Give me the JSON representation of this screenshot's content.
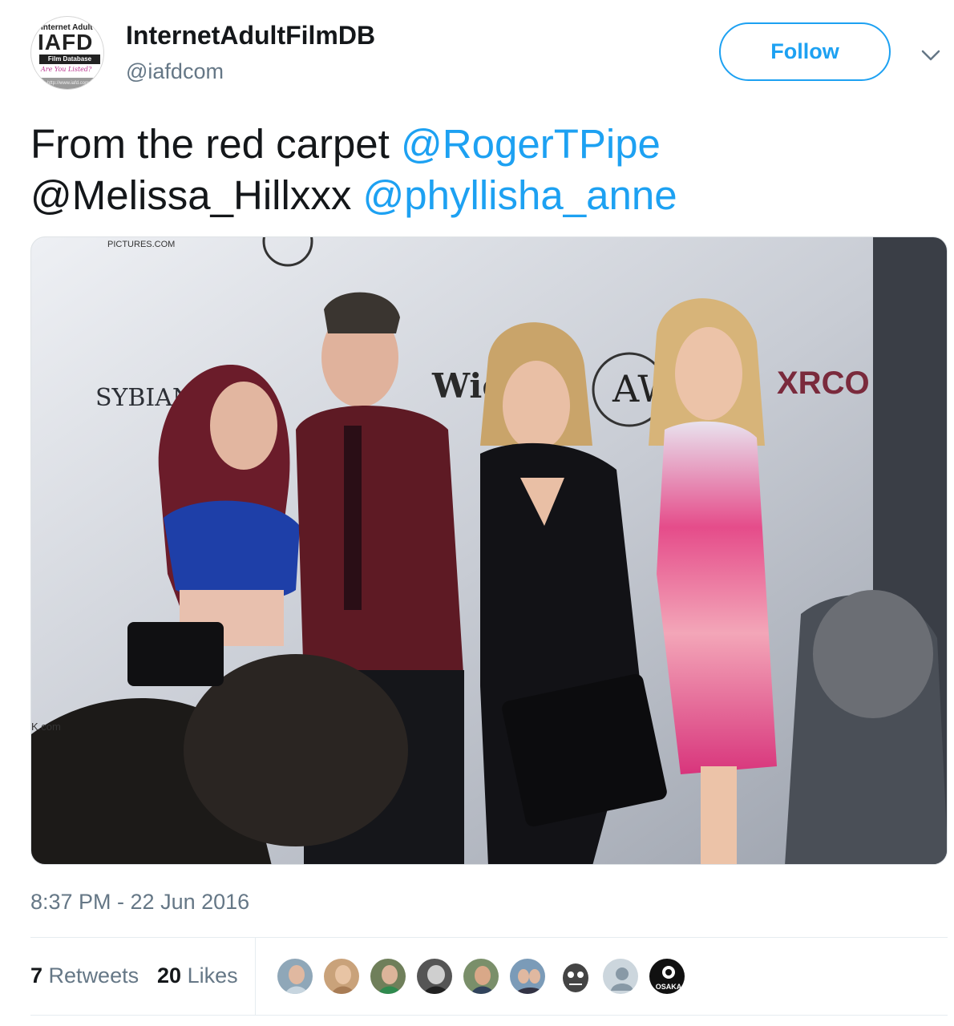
{
  "account": {
    "display_name": "InternetAdultFilmDB",
    "handle": "@iafdcom",
    "avatar": {
      "logo_top": "Internet Adult",
      "logo_main": "IAFD",
      "logo_sub": "Film Database",
      "logo_tag": "Are You Listed?",
      "logo_url": "http://www.iafd.com"
    }
  },
  "follow_button": {
    "label": "Follow"
  },
  "more_menu": {
    "icon": "chevron-down-icon"
  },
  "tweet": {
    "text_prefix": "From the red carpet ",
    "mentions": [
      "@RogerTPipe",
      "@Melissa_Hillxxx",
      "@phyllisha_anne"
    ],
    "media_description_icon": "photo",
    "backdrop_logos": [
      "SYBIAN",
      "XRCO",
      "Wicked",
      "AW",
      "PICTURES.COM"
    ],
    "timestamp": "8:37 PM - 22 Jun 2016"
  },
  "stats": {
    "retweets_count": "7",
    "retweets_label": "Retweets",
    "likes_count": "20",
    "likes_label": "Likes"
  },
  "likers": [
    {
      "name": "liker-1",
      "color": "#8fa7b8"
    },
    {
      "name": "liker-2",
      "color": "#c9a27a"
    },
    {
      "name": "liker-3",
      "color": "#6f7f5a"
    },
    {
      "name": "liker-4",
      "color": "#555555"
    },
    {
      "name": "liker-5",
      "color": "#7a8f6a"
    },
    {
      "name": "liker-6",
      "color": "#7b9bb8"
    },
    {
      "name": "liker-7",
      "color": "#444444"
    },
    {
      "name": "liker-8",
      "color": "#ccd6dd"
    },
    {
      "name": "liker-9",
      "color": "#111111"
    }
  ],
  "liker_9_label": "OSAKA",
  "colors": {
    "link": "#1da1f2",
    "secondary_text": "#657786",
    "primary_text": "#14171a"
  }
}
